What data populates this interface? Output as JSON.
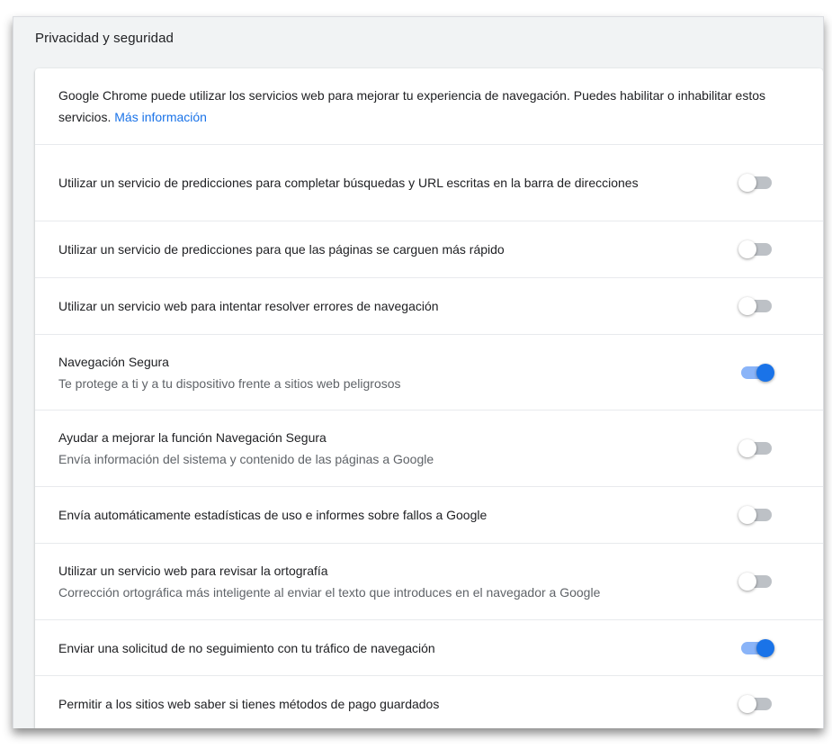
{
  "section": {
    "title": "Privacidad y seguridad"
  },
  "intro": {
    "text": "Google Chrome puede utilizar los servicios web para mejorar tu experiencia de navegación. Puedes habilitar o inhabilitar estos servicios.",
    "link": "Más información"
  },
  "settings": [
    {
      "label": "Utilizar un servicio de predicciones para completar búsquedas y URL escritas en la barra de direcciones",
      "sublabel": "",
      "enabled": false
    },
    {
      "label": "Utilizar un servicio de predicciones para que las páginas se carguen más rápido",
      "sublabel": "",
      "enabled": false
    },
    {
      "label": "Utilizar un servicio web para intentar resolver errores de navegación",
      "sublabel": "",
      "enabled": false
    },
    {
      "label": "Navegación Segura",
      "sublabel": "Te protege a ti y a tu dispositivo frente a sitios web peligrosos",
      "enabled": true
    },
    {
      "label": "Ayudar a mejorar la función Navegación Segura",
      "sublabel": "Envía información del sistema y contenido de las páginas a Google",
      "enabled": false
    },
    {
      "label": "Envía automáticamente estadísticas de uso e informes sobre fallos a Google",
      "sublabel": "",
      "enabled": false
    },
    {
      "label": "Utilizar un servicio web para revisar la ortografía",
      "sublabel": "Corrección ortográfica más inteligente al enviar el texto que introduces en el navegador a Google",
      "enabled": false
    },
    {
      "label": "Enviar una solicitud de no seguimiento con tu tráfico de navegación",
      "sublabel": "",
      "enabled": true
    },
    {
      "label": "Permitir a los sitios web saber si tienes métodos de pago guardados",
      "sublabel": "",
      "enabled": false
    }
  ],
  "colors": {
    "accent": "#1a73e8",
    "toggle_on_track": "#8ab4f8",
    "toggle_off_track": "#bdc1c6"
  }
}
